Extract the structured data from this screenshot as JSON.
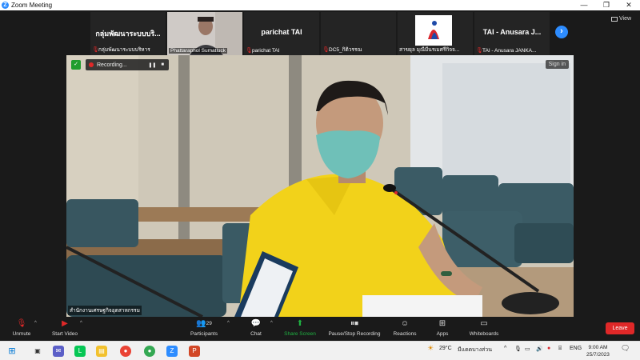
{
  "window": {
    "title": "Zoom Meeting",
    "minimize": "—",
    "maximize": "❐",
    "close": "✕"
  },
  "gallery": {
    "tiles": [
      {
        "big_label": "กลุ่มพัฒนาระบบบริ...",
        "name": "กลุ่มพัฒนาระบบบริหาร",
        "muted": true
      },
      {
        "big_label": "",
        "name": "Phattaraphol Sumatluck",
        "muted": false
      },
      {
        "big_label": "parichat TAI",
        "name": "parichat TAI",
        "muted": true
      },
      {
        "big_label": "",
        "name": "DC5_กิติวรรณ",
        "muted": true
      },
      {
        "big_label": "",
        "name": "สาขยุล มุณีมีนรเมศรีกิจจ...",
        "muted": false
      },
      {
        "big_label": "TAI - Anusara  J...",
        "name": "TAI - Anusara  JANKA...",
        "muted": true
      }
    ],
    "next_label": "›",
    "view_label": "View"
  },
  "video": {
    "recording_label": "Recording...",
    "pause_symbol": "❚❚",
    "stop_symbol": "■",
    "signin_label": "Sign in",
    "caption": "สำนักงานเศรษฐกิจอุตสาหกรรม"
  },
  "toolbar": {
    "unmute": "Unmute",
    "start_video": "Start Video",
    "participants": "Participants",
    "participant_count": "29",
    "chat": "Chat",
    "share_screen": "Share Screen",
    "pause_stop_recording": "Pause/Stop Recording",
    "reactions": "Reactions",
    "apps": "Apps",
    "whiteboards": "Whiteboards",
    "leave": "Leave"
  },
  "taskbar": {
    "weather_temp": "29°C",
    "weather_desc": "มีแดดบางส่วน",
    "language": "ENG",
    "time": "9:00 AM",
    "date": "25/7/2023"
  },
  "colors": {
    "zoom_blue": "#2d8cff",
    "leave_red": "#e02828",
    "share_green": "#1fb141",
    "toolbar_bg": "#1a1a1a"
  }
}
